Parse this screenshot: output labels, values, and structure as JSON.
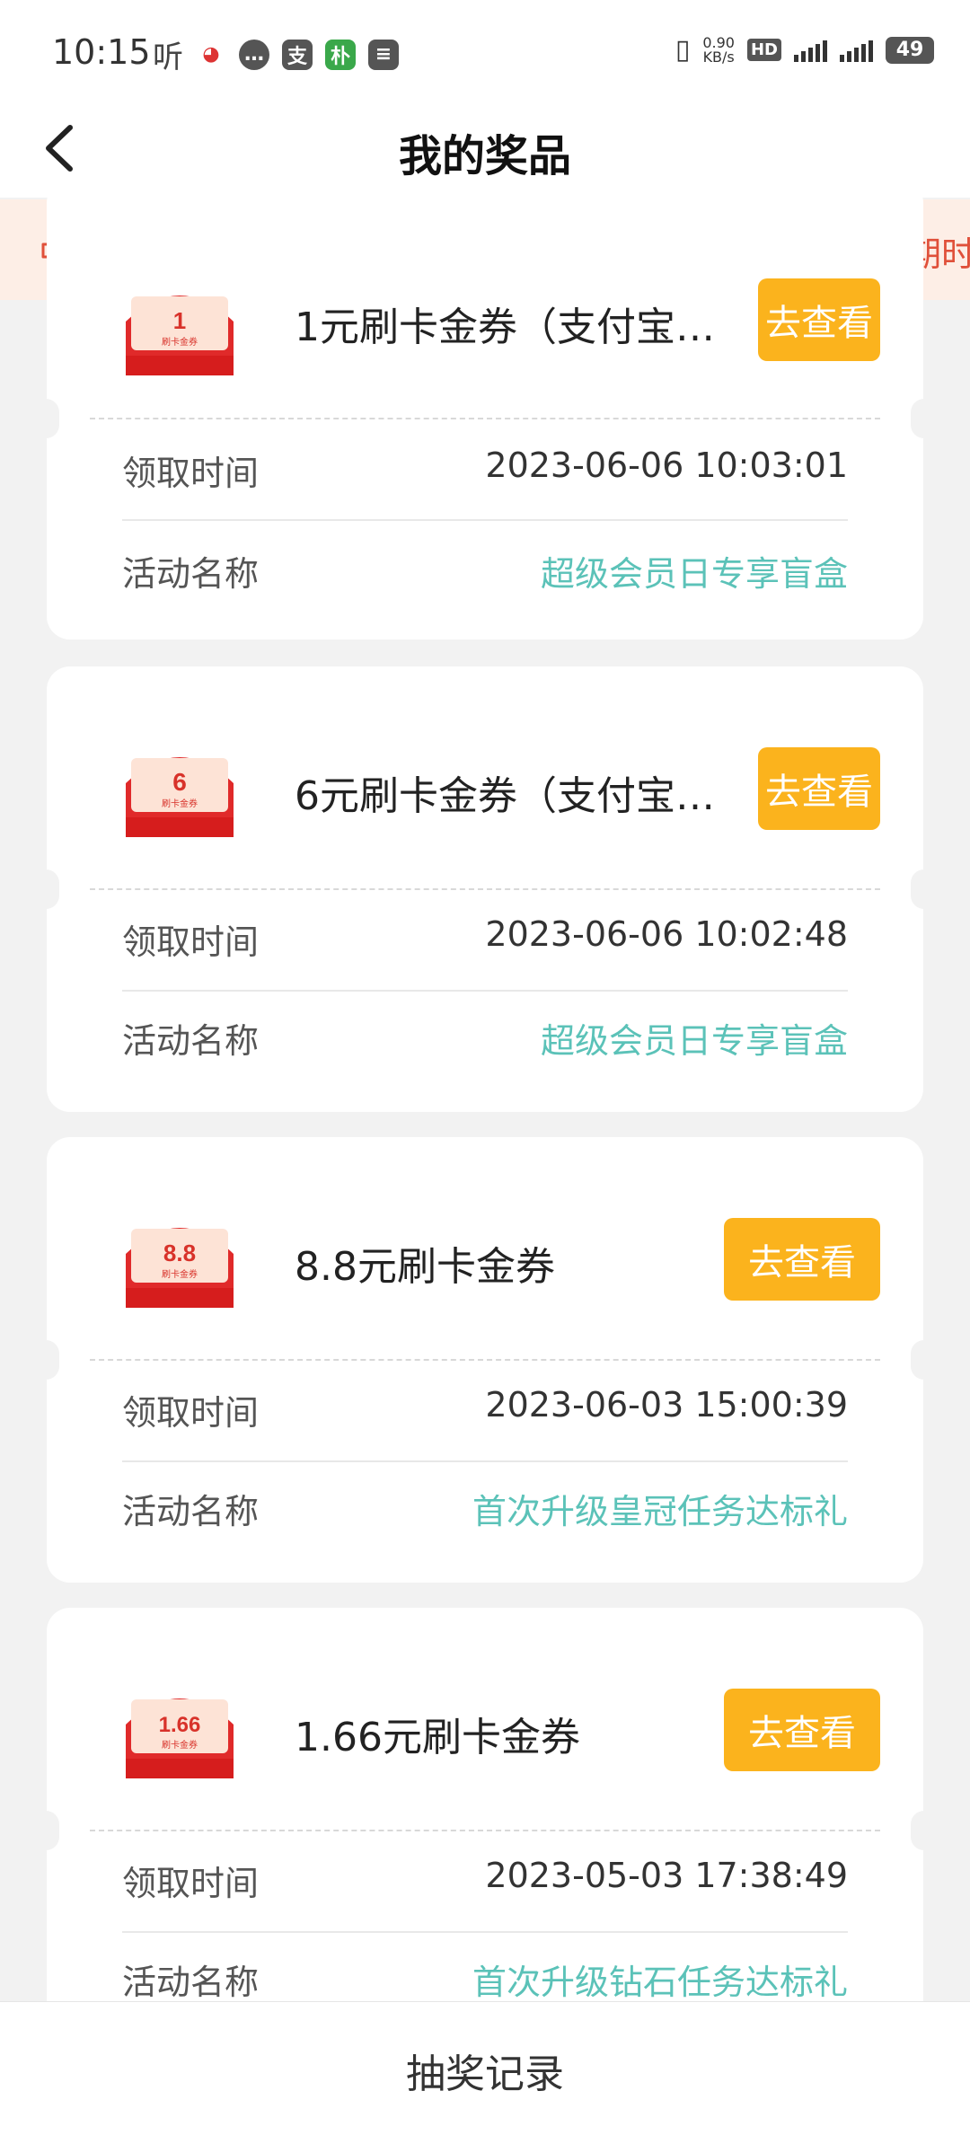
{
  "status_bar": {
    "time": "10:15",
    "network_speed": "0.90\nKB/s",
    "battery": "49",
    "icons": [
      "listen-icon",
      "weibo-icon",
      "chat-icon",
      "alipay-icon",
      "pinduoduo-icon",
      "message-icon"
    ]
  },
  "header": {
    "title": "我的奖品"
  },
  "notice": {
    "text": "活动高峰期时"
  },
  "prizes": [
    {
      "amount": "1",
      "name": "1元刷卡金券（支付宝…",
      "button": "去查看",
      "time_label": "领取时间",
      "time": "2023-06-06 10:03:01",
      "activity_label": "活动名称",
      "activity": "超级会员日专享盲盒"
    },
    {
      "amount": "6",
      "name": "6元刷卡金券（支付宝…",
      "button": "去查看",
      "time_label": "领取时间",
      "time": "2023-06-06 10:02:48",
      "activity_label": "活动名称",
      "activity": "超级会员日专享盲盒"
    },
    {
      "amount": "8.8",
      "name": "8.8元刷卡金券",
      "button": "去查看",
      "time_label": "领取时间",
      "time": "2023-06-03 15:00:39",
      "activity_label": "活动名称",
      "activity": "首次升级皇冠任务达标礼"
    },
    {
      "amount": "1.66",
      "name": "1.66元刷卡金券",
      "button": "去查看",
      "time_label": "领取时间",
      "time": "2023-05-03 17:38:49",
      "activity_label": "活动名称",
      "activity": "首次升级钻石任务达标礼"
    }
  ],
  "coupon_caption": "刷卡金券",
  "bottom_bar": {
    "label": "抽奖记录"
  },
  "colors": {
    "accent_button": "#fbb31d",
    "activity_text": "#5bc2b8",
    "notice_text": "#e0503a",
    "coupon_red": "#e02a2a"
  }
}
